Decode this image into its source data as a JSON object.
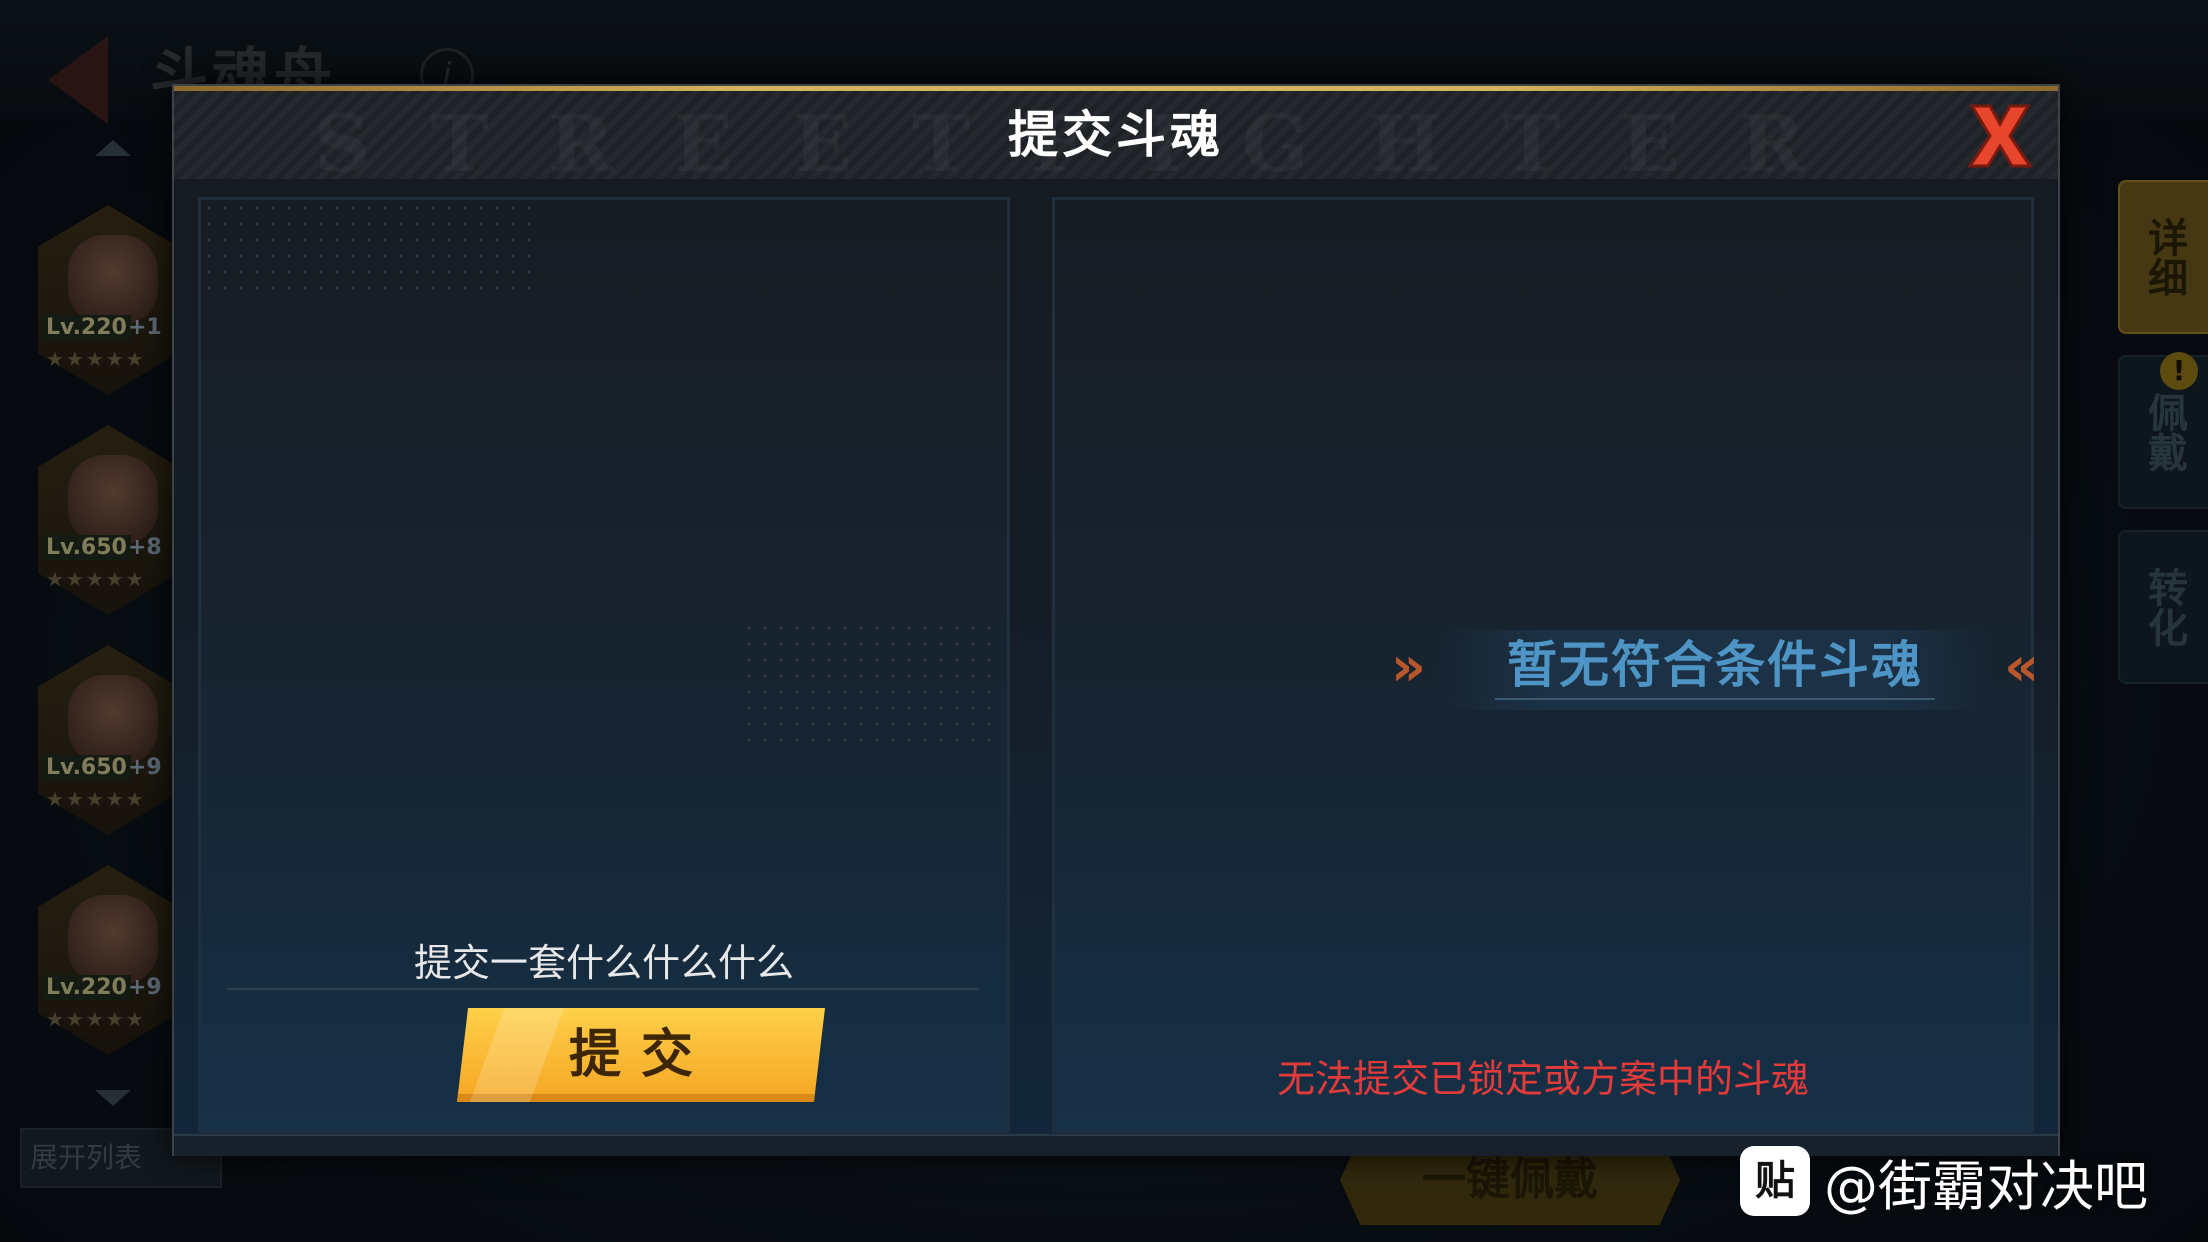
{
  "background": {
    "page_title": "斗魂舟",
    "info_icon_glyph": "i",
    "heroes": [
      {
        "level": "Lv.220",
        "plus": "+1",
        "stars": "★★★★★"
      },
      {
        "level": "Lv.650",
        "plus": "+8",
        "stars": "★★★★★"
      },
      {
        "level": "Lv.650",
        "plus": "+9",
        "stars": "★★★★★"
      },
      {
        "level": "Lv.220",
        "plus": "+9",
        "stars": "★★★★★"
      }
    ],
    "expand_list_label": "展开列表",
    "side_tabs": [
      "详细",
      "佩戴",
      "转化"
    ],
    "warning_badge": "!",
    "one_key_wear_label": "一键佩戴"
  },
  "modal": {
    "title": "提交斗魂",
    "header_watermark": "STREETFIGHTER",
    "left_panel": {
      "description": "提交一套什么什么什么",
      "submit_label": "提交"
    },
    "right_panel": {
      "empty_message": "暂无符合条件斗魂",
      "warning": "无法提交已锁定或方案中的斗魂"
    }
  },
  "watermark": {
    "logo_glyph": "贴",
    "text": "@街霸对决吧"
  },
  "colors": {
    "accent_gold": "#f5a623",
    "empty_blue": "#4e95c6",
    "warning_red": "#e33a3a",
    "close_red": "#e8462c"
  }
}
